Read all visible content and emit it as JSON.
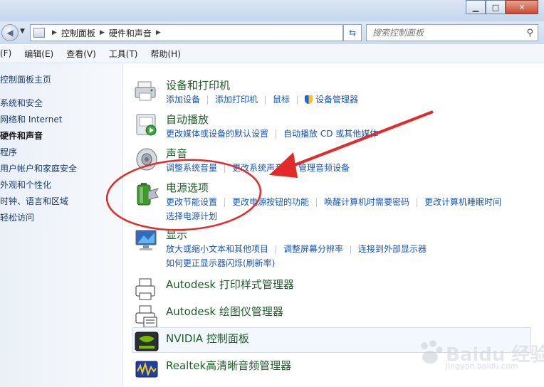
{
  "window": {
    "min_icon": "minimize-icon",
    "max_icon": "maximize-icon",
    "close_icon": "close-icon"
  },
  "nav": {
    "breadcrumb": [
      "控制面板",
      "硬件和声音"
    ],
    "search_placeholder": "搜索控制面板"
  },
  "menu": [
    "(F)",
    "编辑(E)",
    "查看(V)",
    "工具(T)",
    "帮助(H)"
  ],
  "sidebar": [
    {
      "label": "控制面板主页",
      "current": false
    },
    {
      "label": "系统和安全",
      "current": false
    },
    {
      "label": "网络和 Internet",
      "current": false
    },
    {
      "label": "硬件和声音",
      "current": true
    },
    {
      "label": "程序",
      "current": false
    },
    {
      "label": "用户帐户和家庭安全",
      "current": false
    },
    {
      "label": "外观和个性化",
      "current": false
    },
    {
      "label": "时钟、语言和区域",
      "current": false
    },
    {
      "label": "轻松访问",
      "current": false
    }
  ],
  "categories": [
    {
      "title": "设备和打印机",
      "icon": "printer-icon",
      "links": [
        [
          "添加设备",
          "添加打印机",
          "鼠标",
          "设备管理器"
        ]
      ]
    },
    {
      "title": "自动播放",
      "icon": "autoplay-icon",
      "links": [
        [
          "更改媒体或设备的默认设置",
          "自动播放 CD 或其他媒体"
        ]
      ]
    },
    {
      "title": "声音",
      "icon": "speaker-icon",
      "links": [
        [
          "调整系统音量",
          "更改系统声音",
          "管理音频设备"
        ]
      ]
    },
    {
      "title": "电源选项",
      "icon": "battery-icon",
      "links": [
        [
          "更改节能设置",
          "更改电源按钮的功能",
          "唤醒计算机时需要密码",
          "更改计算机睡眠时间"
        ],
        [
          "选择电源计划"
        ]
      ]
    },
    {
      "title": "显示",
      "icon": "display-icon",
      "links": [
        [
          "放大或缩小文本和其他项目",
          "调整屏幕分辨率",
          "连接到外部显示器"
        ],
        [
          "如何更正显示器闪烁(刷新率)"
        ]
      ]
    },
    {
      "title": "Autodesk 打印样式管理器",
      "icon": "autodesk-printer-icon",
      "links": []
    },
    {
      "title": "Autodesk 绘图仪管理器",
      "icon": "plotter-icon",
      "links": []
    },
    {
      "title": "NVIDIA 控制面板",
      "icon": "nvidia-icon",
      "links": []
    },
    {
      "title": "Realtek高清晰音频管理器",
      "icon": "realtek-icon",
      "links": []
    }
  ],
  "watermark": {
    "brand": "Baidu 经验",
    "url": "jingyan.baidu.com"
  },
  "annotation": {
    "color": "#e12b2b"
  }
}
